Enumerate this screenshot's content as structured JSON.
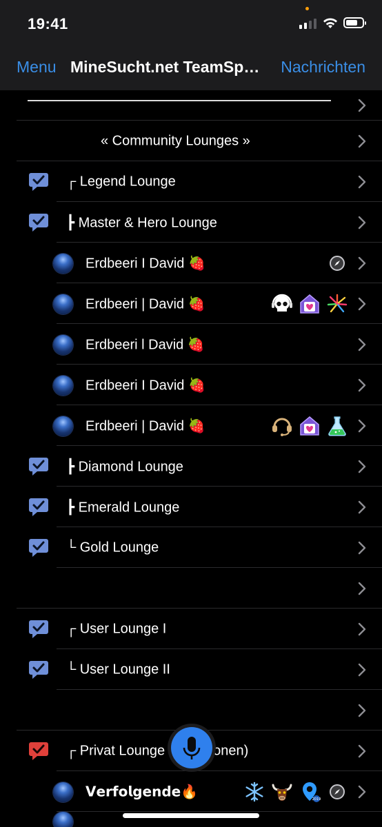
{
  "status_bar": {
    "time": "19:41"
  },
  "nav": {
    "left": "Menu",
    "title": "MineSucht.net TeamSpeak",
    "right": "Nachrichten"
  },
  "rows": {
    "divider": "",
    "community": "« Community Lounges »",
    "legend": "┌ Legend Lounge",
    "master": "┣ Master & Hero Lounge",
    "user1": "Erdbeeri I David 🍓",
    "user2": "Erdbeeri | David 🍓",
    "user3": "Erdbeeri l David 🍓",
    "user4": "Erdbeeri I David 🍓",
    "user5": "Erdbeeri | David 🍓",
    "diamond": "┣ Diamond Lounge",
    "emerald": "┣ Emerald Lounge",
    "gold": "└ Gold Lounge",
    "user_lounge_1": "┌ User Lounge I",
    "user_lounge_2": "└ User Lounge II",
    "privat": "┌ Privat Lounge (2 Personen)",
    "follower": "𝗩𝗲𝗿𝗳𝗼𝗹𝗴𝗲𝗻𝗱𝗲🔥"
  },
  "icons": {
    "row_badges_user2": [
      "skull-headphones-icon",
      "heart-house-icon",
      "fireworks-icon"
    ],
    "row_badges_user5": [
      "headset-icon",
      "heart-house-icon",
      "flask-icon"
    ],
    "row_badges_user1": [
      "compass-icon"
    ],
    "row_badges_follower": [
      "snowflake-icon",
      "bull-icon",
      "location-pin-icon",
      "compass-icon"
    ]
  },
  "colors": {
    "accent": "#3a8ee6",
    "channel_bubble": "#6f8fd8",
    "private_bubble": "#e0403a",
    "mic": "#2f80ed"
  }
}
